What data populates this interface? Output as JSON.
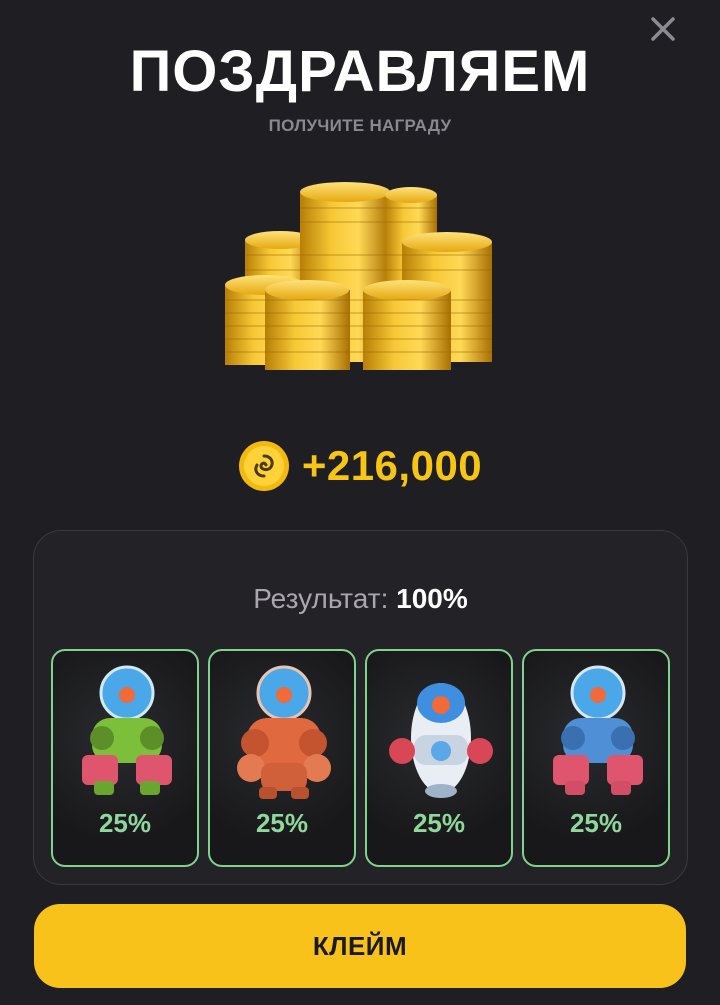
{
  "header": {
    "title": "ПОЗДРАВЛЯЕМ",
    "subtitle": "ПОЛУЧИТЕ НАГРАДУ",
    "close_icon": "close-icon"
  },
  "reward": {
    "image": "gold-coin-stacks",
    "currency_icon": "spiral-coin-icon",
    "amount": "+216,000",
    "amount_color": "#f7c514"
  },
  "result": {
    "label": "Результат:",
    "value": "100%",
    "cards": [
      {
        "robot": "robot-green",
        "percent": "25%"
      },
      {
        "robot": "robot-orange",
        "percent": "25%"
      },
      {
        "robot": "robot-blue-white",
        "percent": "25%"
      },
      {
        "robot": "robot-blue-pink",
        "percent": "25%"
      }
    ],
    "card_border_color": "#7fd38d",
    "percent_color": "#8fd79a"
  },
  "actions": {
    "claim_label": "КЛЕЙМ",
    "claim_color": "#f8c21a"
  }
}
